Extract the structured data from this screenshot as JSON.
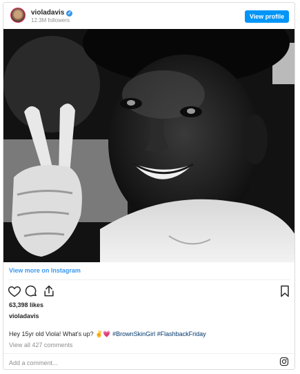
{
  "header": {
    "username": "violadavis",
    "followers": "12.3M followers",
    "view_profile_label": "View profile"
  },
  "post": {
    "view_more_label": "View more on Instagram",
    "likes": "63,398 likes",
    "caption_username": "violadavis",
    "caption_text": "Hey 15yr old Viola! What's up?",
    "caption_emojis": "✌️💗",
    "hashtags": "#BrownSkinGirl #FlashbackFriday",
    "view_comments": "View all 427 comments",
    "add_comment_placeholder": "Add a comment..."
  },
  "icons": {
    "like": "heart-icon",
    "comment": "comment-icon",
    "share": "share-icon",
    "save": "bookmark-icon",
    "instagram": "instagram-logo-icon",
    "verified": "verified-badge-icon"
  },
  "colors": {
    "accent": "#0095f6",
    "link": "#3897f0",
    "hashtag": "#003569",
    "muted": "#8e8e8e",
    "text": "#262626"
  }
}
